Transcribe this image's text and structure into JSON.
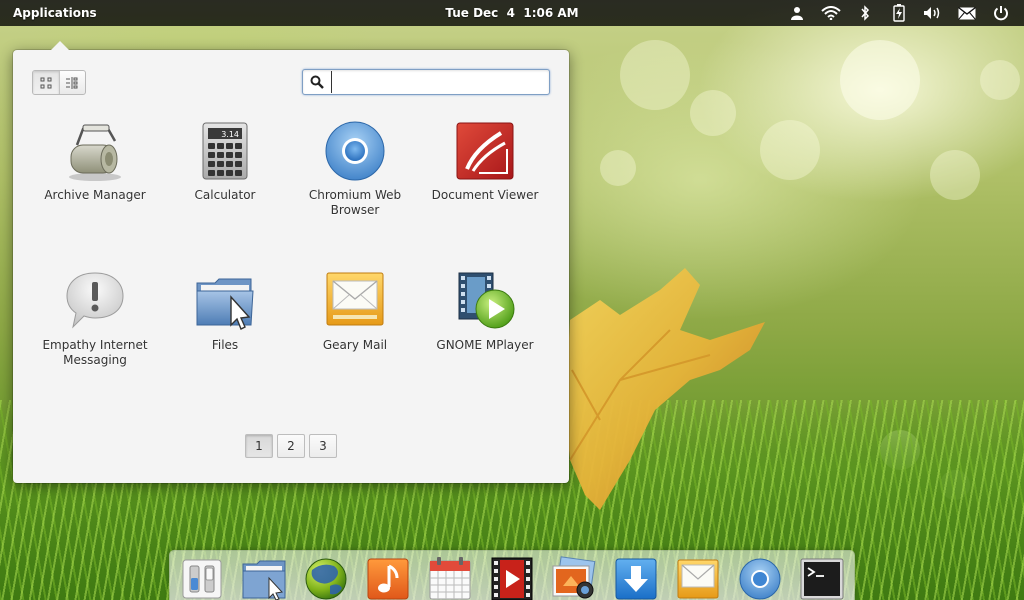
{
  "top_panel": {
    "applications_label": "Applications",
    "clock": "Tue Dec  4  1:06 AM",
    "indicators": [
      {
        "name": "user-icon"
      },
      {
        "name": "wifi-icon"
      },
      {
        "name": "bluetooth-icon"
      },
      {
        "name": "battery-icon"
      },
      {
        "name": "volume-icon"
      },
      {
        "name": "mail-icon"
      },
      {
        "name": "power-icon"
      }
    ]
  },
  "apps_menu": {
    "view_modes": [
      "grid-view",
      "category-view"
    ],
    "active_view": "grid-view",
    "search": {
      "value": "",
      "placeholder": ""
    },
    "apps": [
      {
        "label": "Archive Manager",
        "icon": "archive-manager-icon"
      },
      {
        "label": "Calculator",
        "icon": "calculator-icon",
        "badge": "3.14"
      },
      {
        "label": "Chromium Web Browser",
        "icon": "chromium-icon"
      },
      {
        "label": "Document Viewer",
        "icon": "document-viewer-icon"
      },
      {
        "label": "Empathy Internet Messaging",
        "icon": "empathy-icon"
      },
      {
        "label": "Files",
        "icon": "files-icon"
      },
      {
        "label": "Geary Mail",
        "icon": "geary-mail-icon"
      },
      {
        "label": "GNOME MPlayer",
        "icon": "gnome-mplayer-icon"
      }
    ],
    "pages": [
      "1",
      "2",
      "3"
    ],
    "active_page": "1"
  },
  "dock": {
    "items": [
      {
        "name": "switchboard-settings"
      },
      {
        "name": "files"
      },
      {
        "name": "web-browser"
      },
      {
        "name": "music"
      },
      {
        "name": "calendar"
      },
      {
        "name": "videos"
      },
      {
        "name": "photos"
      },
      {
        "name": "downloads"
      },
      {
        "name": "mail"
      },
      {
        "name": "chromium"
      },
      {
        "name": "terminal"
      }
    ]
  },
  "colors": {
    "panel": "#111111",
    "menu_background": "#f4f4f4",
    "search_focus": "#7f9fc4",
    "label_text": "#333333"
  }
}
